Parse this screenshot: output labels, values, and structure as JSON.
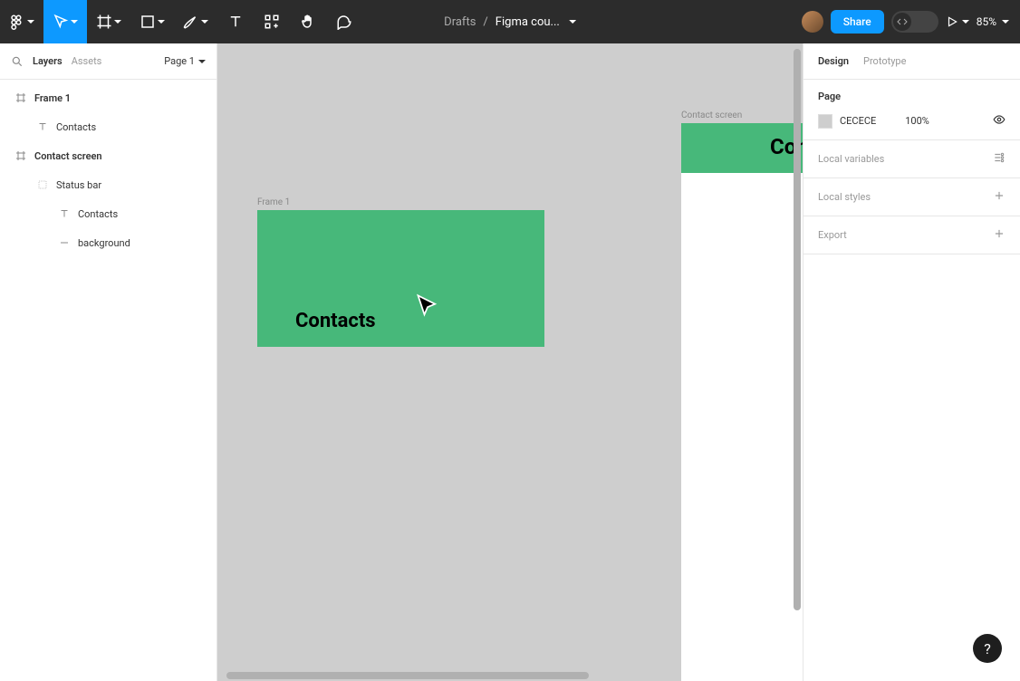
{
  "toolbar": {
    "icons": {
      "menu": "figma-menu-icon",
      "move": "move-tool-icon",
      "frame": "frame-tool-icon",
      "shape": "rectangle-tool-icon",
      "pen": "pen-tool-icon",
      "text": "text-tool-icon",
      "resources": "resources-icon",
      "hand": "hand-tool-icon",
      "comment": "comment-icon"
    },
    "breadcrumb": {
      "parent": "Drafts",
      "sep": "/",
      "file": "Figma cou..."
    },
    "share_label": "Share",
    "zoom": "85%"
  },
  "left": {
    "tab_layers": "Layers",
    "tab_assets": "Assets",
    "page_label": "Page 1",
    "tree": [
      {
        "name": "Frame 1",
        "icon": "frame-icon",
        "bold": true,
        "indent": 0
      },
      {
        "name": "Contacts",
        "icon": "text-icon",
        "bold": false,
        "indent": 1
      },
      {
        "name": "Contact screen",
        "icon": "frame-icon",
        "bold": true,
        "indent": 0
      },
      {
        "name": "Status bar",
        "icon": "group-icon",
        "bold": false,
        "indent": 1
      },
      {
        "name": "Contacts",
        "icon": "text-icon",
        "bold": false,
        "indent": 2
      },
      {
        "name": "background",
        "icon": "line-icon",
        "bold": false,
        "indent": 2
      }
    ]
  },
  "canvas": {
    "bg_hex": "CECECE",
    "frame1": {
      "label": "Frame 1",
      "text": "Contacts"
    },
    "frame2": {
      "label": "Contact screen",
      "text": "Cont"
    }
  },
  "right": {
    "tab_design": "Design",
    "tab_prototype": "Prototype",
    "page_section": {
      "title": "Page",
      "color_hex": "CECECE",
      "opacity": "100%"
    },
    "local_variables": "Local variables",
    "local_styles": "Local styles",
    "export": "Export"
  },
  "help": "?"
}
